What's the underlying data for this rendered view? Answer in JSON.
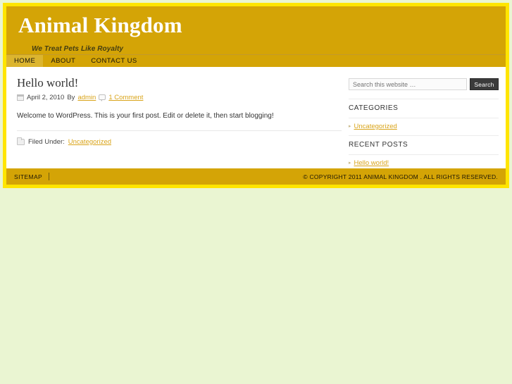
{
  "site": {
    "title": "Animal Kingdom",
    "tagline": "We Treat Pets Like Royalty",
    "colors": {
      "page_background": "#eaf5d2",
      "frame_border": "#ffe500",
      "header_gold": "#d4a406",
      "link_gold": "#d9a41a",
      "nav_active": "#dcb52f",
      "search_button": "#3b3b3b"
    }
  },
  "nav": {
    "items": [
      {
        "label": "HOME",
        "active": true
      },
      {
        "label": "ABOUT",
        "active": false
      },
      {
        "label": "CONTACT US",
        "active": false
      }
    ]
  },
  "post": {
    "title": "Hello world!",
    "date": "April 2, 2010",
    "by_label": "By",
    "author": "admin",
    "comments": "1 Comment",
    "body": "Welcome to WordPress. This is your first post. Edit or delete it, then start blogging!",
    "filed_under_label": "Filed Under:",
    "category": "Uncategorized",
    "icons": {
      "date": "calendar-icon",
      "comments": "comment-bubble-icon",
      "category": "folder-icon"
    }
  },
  "sidebar": {
    "search": {
      "placeholder": "Search this website …",
      "value": "",
      "button_label": "Search"
    },
    "widgets": [
      {
        "title": "CATEGORIES",
        "items": [
          "Uncategorized"
        ]
      },
      {
        "title": "RECENT POSTS",
        "items": [
          "Hello world!"
        ]
      }
    ]
  },
  "footer": {
    "sitemap": "SITEMAP",
    "copyright": "© COPYRIGHT 2011 ANIMAL KINGDOM . ALL RIGHTS RESERVED."
  }
}
